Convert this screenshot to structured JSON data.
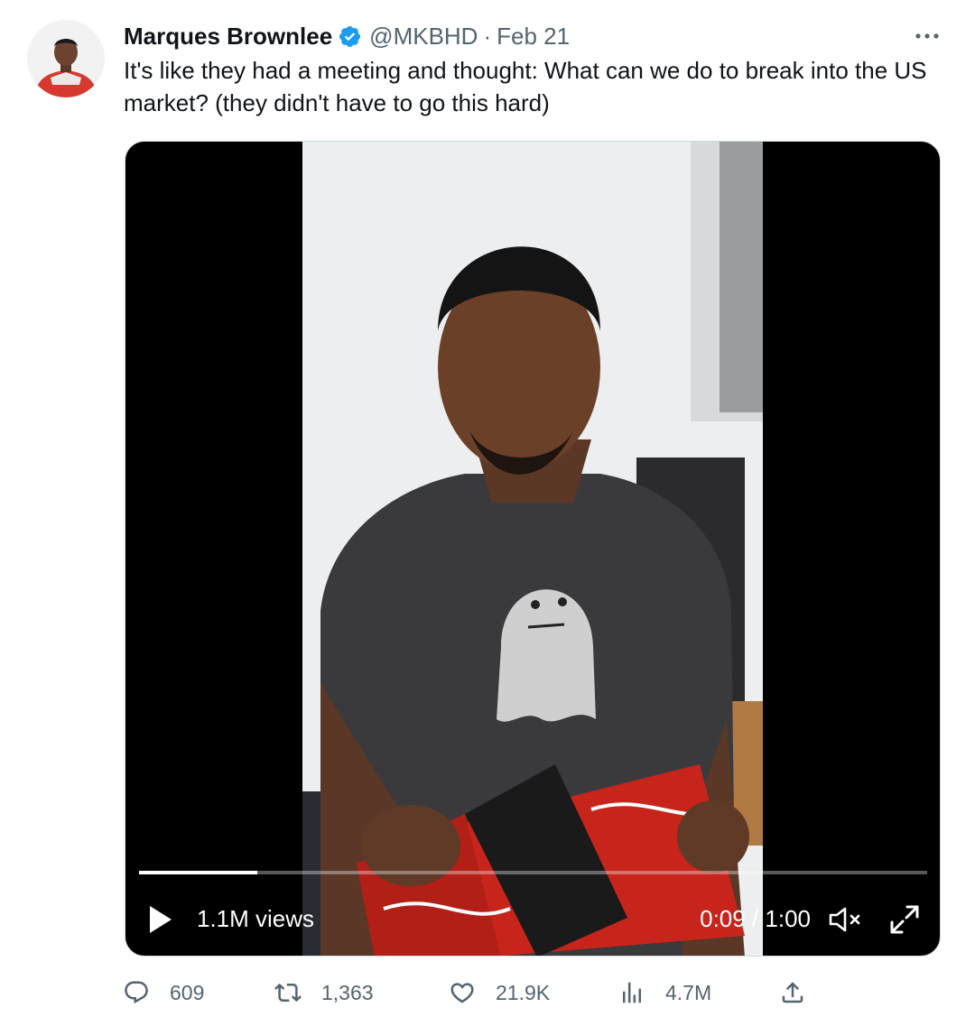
{
  "author": {
    "name": "Marques Brownlee",
    "handle": "@MKBHD",
    "separator": "·",
    "date": "Feb 21"
  },
  "tweet": {
    "text": "It's like they had a meeting and thought: What can we do to break into the US market? (they didn't have to go this hard)"
  },
  "video": {
    "views": "1.1M views",
    "time": "0:09 / 1:00",
    "progress_fraction": 0.15
  },
  "actions": {
    "replies": "609",
    "retweets": "1,363",
    "likes": "21.9K",
    "views": "4.7M"
  },
  "icons": {
    "verified": "verified-badge-icon",
    "more": "more-icon",
    "play": "play-icon",
    "mute": "muted-icon",
    "fullscreen": "fullscreen-icon",
    "reply": "reply-icon",
    "retweet": "retweet-icon",
    "like": "heart-icon",
    "analytics": "analytics-icon",
    "share": "share-icon"
  },
  "colors": {
    "verified": "#1d9bf0",
    "secondary_text": "#536471",
    "primary_text": "#0f1419",
    "box_red": "#c7241c"
  }
}
